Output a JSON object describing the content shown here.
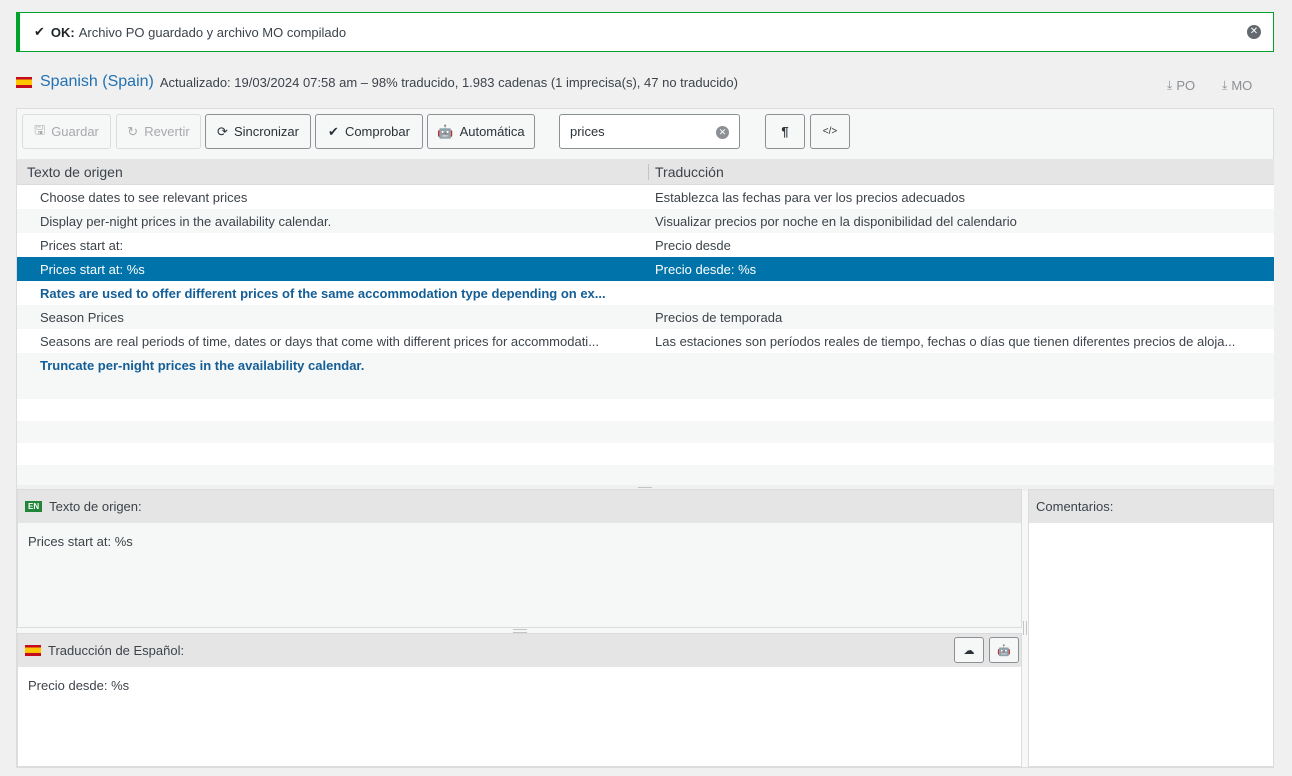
{
  "notice": {
    "status": "OK:",
    "message": "Archivo PO guardado y archivo MO compilado",
    "check_icon": "checkmark-icon",
    "dismiss_icon": "close-circle-icon"
  },
  "header": {
    "language": "Spanish (Spain)",
    "summary": "Actualizado: 19/03/2024 07:58 am – 98% traducido, 1.983 cadenas (1 imprecisa(s), 47 no traducido)",
    "download_po": "PO",
    "download_mo": "MO"
  },
  "toolbar": {
    "save": "Guardar",
    "revert": "Revertir",
    "sync": "Sincronizar",
    "check": "Comprobar",
    "auto": "Automática",
    "search_value": "prices",
    "invisibles_icon": "¶",
    "code_icon": "</>"
  },
  "list": {
    "col_source": "Texto de origen",
    "col_target": "Traducción",
    "rows": [
      {
        "source": "Choose dates to see relevant prices",
        "target": "Establezca las fechas para ver los precios adecuados"
      },
      {
        "source": "Display per-night prices in the availability calendar.",
        "target": "Visualizar precios por noche en la disponibilidad del calendario"
      },
      {
        "source": "Prices start at:",
        "target": "Precio desde"
      },
      {
        "source": "Prices start at: %s",
        "target": "Precio desde: %s"
      },
      {
        "source": "Rates are used to offer different prices of the same accommodation type depending on ex...",
        "target": ""
      },
      {
        "source": "Season Prices",
        "target": "Precios de temporada"
      },
      {
        "source": "Seasons are real periods of time, dates or days that come with different prices for accommodati...",
        "target": "Las estaciones son períodos reales de tiempo, fechas o días que tienen diferentes precios de aloja..."
      },
      {
        "source": "Truncate per-night prices in the availability calendar.",
        "target": ""
      }
    ]
  },
  "source_pane": {
    "badge": "EN",
    "title": "Texto de origen:",
    "text": "Prices start at: %s"
  },
  "target_pane": {
    "title": "Traducción de Español:",
    "text": "Precio desde: %s"
  },
  "comments_pane": {
    "title": "Comentarios:"
  },
  "colors": {
    "accent": "#0073aa",
    "success": "#00a32a",
    "link": "#2271b1"
  }
}
